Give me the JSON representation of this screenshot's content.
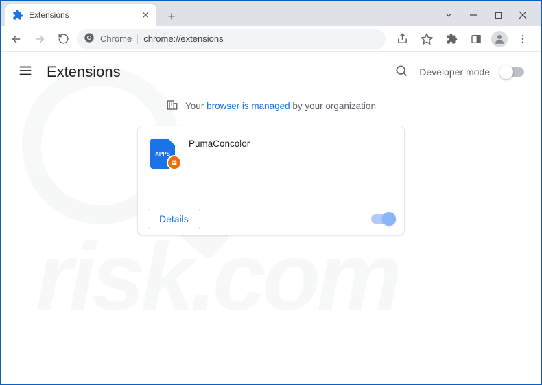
{
  "tab": {
    "title": "Extensions"
  },
  "omnibox": {
    "prefix_label": "Chrome",
    "url": "chrome://extensions"
  },
  "page": {
    "title": "Extensions",
    "developer_mode_label": "Developer mode"
  },
  "managed_banner": {
    "prefix": "Your ",
    "link_text": "browser is managed",
    "suffix": " by your organization"
  },
  "extension": {
    "name": "PumaConcolor",
    "icon_text": "APPS",
    "details_label": "Details",
    "enabled": true
  },
  "watermark": {
    "text": "risk.com"
  }
}
